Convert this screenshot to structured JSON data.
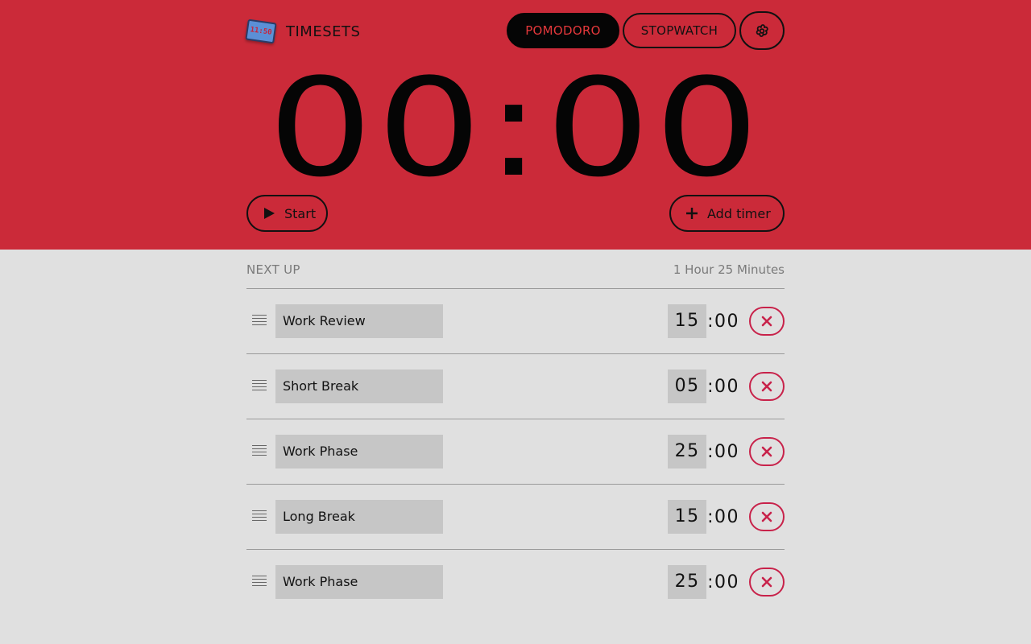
{
  "app": {
    "logo_badge_text": "11:50",
    "title": "TIMESETS"
  },
  "modes": {
    "pomodoro_label": "POMODORO",
    "stopwatch_label": "STOPWATCH",
    "active": "pomodoro"
  },
  "clock": {
    "display": "00:00"
  },
  "controls": {
    "start_label": "Start",
    "add_timer_label": "Add timer"
  },
  "next_up": {
    "label": "NEXT UP",
    "total_duration": "1 Hour 25 Minutes",
    "timers": [
      {
        "name": "Work Review",
        "minutes": "15",
        "seconds": ":00"
      },
      {
        "name": "Short Break",
        "minutes": "05",
        "seconds": ":00"
      },
      {
        "name": "Work Phase",
        "minutes": "25",
        "seconds": ":00"
      },
      {
        "name": "Long Break",
        "minutes": "15",
        "seconds": ":00"
      },
      {
        "name": "Work Phase",
        "minutes": "25",
        "seconds": ":00"
      }
    ]
  },
  "colors": {
    "accent_red": "#cb2a39",
    "background": "#e0e0e0",
    "delete_red": "#c8224a",
    "active_pill_text": "#e5383b"
  },
  "icons": {
    "settings": "flower-gear-icon",
    "start": "play-icon",
    "add": "plus-icon",
    "drag": "drag-handle-icon",
    "delete": "close-icon"
  }
}
